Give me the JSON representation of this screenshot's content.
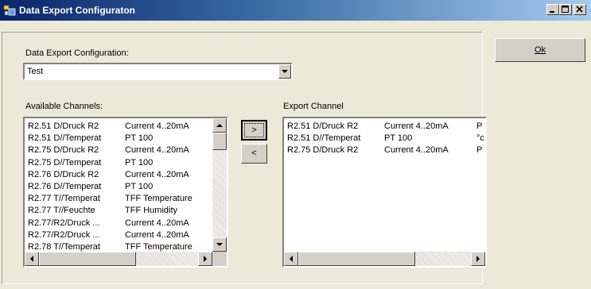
{
  "window": {
    "title": "Data Export Configuraton"
  },
  "config": {
    "label": "Data Export Configuration:",
    "selected": "Test"
  },
  "available": {
    "label": "Available Channels:",
    "rows": [
      [
        "R2.51 D/Druck R2",
        "Current 4..20mA"
      ],
      [
        "R2.51 D//Temperat",
        "PT 100"
      ],
      [
        "R2.75 D/Druck R2",
        "Current 4..20mA"
      ],
      [
        "R2.75 D//Temperat",
        "PT 100"
      ],
      [
        "R2.76 D/Druck R2",
        "Current 4..20mA"
      ],
      [
        "R2.76 D//Temperat",
        "PT 100"
      ],
      [
        "R2.77 T//Temperat",
        "TFF Temperature"
      ],
      [
        "R2.77 T//Feuchte",
        "TFF Humidity"
      ],
      [
        "R2.77/R2/Druck ...",
        "Current 4..20mA"
      ],
      [
        "R2.77/R2/Druck ...",
        "Current 4..20mA"
      ],
      [
        "R2.78 T//Temperat",
        "TFF Temperature"
      ]
    ]
  },
  "export": {
    "label": "Export Channel",
    "rows": [
      [
        "R2.51 D/Druck R2",
        "Current 4..20mA",
        "P"
      ],
      [
        "R2.51 D//Temperat",
        "PT 100",
        "°c"
      ],
      [
        "R2.75 D/Druck R2",
        "Current 4..20mA",
        "P"
      ]
    ]
  },
  "buttons": {
    "add": ">",
    "remove": "<",
    "ok": "Ok"
  },
  "icons": [
    "app-icon",
    "minimize-icon",
    "maximize-icon",
    "close-icon",
    "dropdown-arrow-icon",
    "scroll-up-icon",
    "scroll-down-icon",
    "scroll-left-icon",
    "scroll-right-icon"
  ]
}
